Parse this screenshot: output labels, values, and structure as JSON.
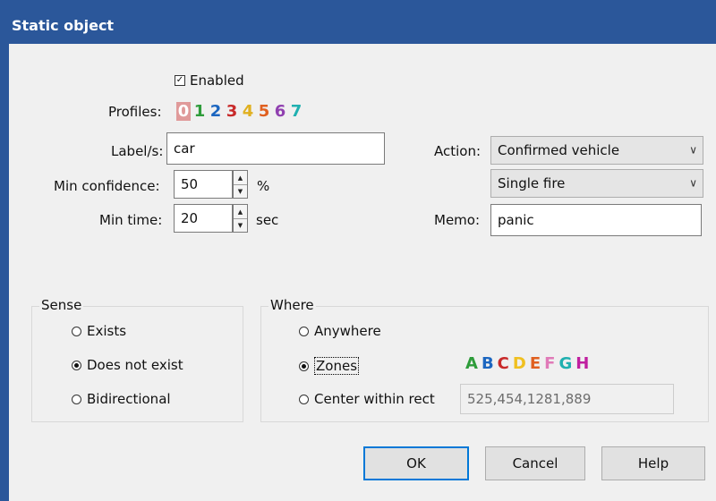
{
  "window": {
    "title": "Static object"
  },
  "enabled": {
    "label": "Enabled",
    "checked": true
  },
  "profiles": {
    "label": "Profiles:",
    "items": [
      {
        "text": "0",
        "color": "#ffffff",
        "bg": "#e09a9a"
      },
      {
        "text": "1",
        "color": "#2e9c3a"
      },
      {
        "text": "2",
        "color": "#1c66c0"
      },
      {
        "text": "3",
        "color": "#c82a2a"
      },
      {
        "text": "4",
        "color": "#e0b020"
      },
      {
        "text": "5",
        "color": "#e06020"
      },
      {
        "text": "6",
        "color": "#9040b0"
      },
      {
        "text": "7",
        "color": "#20b0b0"
      }
    ]
  },
  "labels_field": {
    "label": "Label/s:",
    "value": "car"
  },
  "min_confidence": {
    "label": "Min confidence:",
    "value": "50",
    "unit": "%"
  },
  "min_time": {
    "label": "Min time:",
    "value": "20",
    "unit": "sec"
  },
  "action": {
    "label": "Action:",
    "value": "Confirmed vehicle",
    "mode": "Single fire"
  },
  "memo": {
    "label": "Memo:",
    "value": "panic"
  },
  "sense": {
    "title": "Sense",
    "options": [
      {
        "label": "Exists",
        "selected": false
      },
      {
        "label": "Does not exist",
        "selected": true
      },
      {
        "label": "Bidirectional",
        "selected": false
      }
    ]
  },
  "where": {
    "title": "Where",
    "options": [
      {
        "label": "Anywhere",
        "selected": false
      },
      {
        "label": "Zones",
        "selected": true
      },
      {
        "label": "Center within rect",
        "selected": false
      }
    ],
    "rect_value": "525,454,1281,889",
    "zones": [
      {
        "text": "A",
        "color": "#2e9c3a"
      },
      {
        "text": "B",
        "color": "#1c66c0"
      },
      {
        "text": "C",
        "color": "#c82a2a"
      },
      {
        "text": "D",
        "color": "#f0c020"
      },
      {
        "text": "E",
        "color": "#e06020"
      },
      {
        "text": "F",
        "color": "#e07ab8"
      },
      {
        "text": "G",
        "color": "#20b0b0"
      },
      {
        "text": "H",
        "color": "#c020a0"
      }
    ]
  },
  "buttons": {
    "ok": "OK",
    "cancel": "Cancel",
    "help": "Help"
  }
}
